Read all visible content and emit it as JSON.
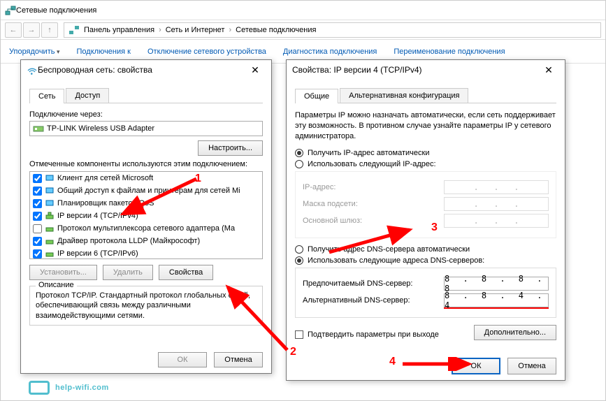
{
  "explorer": {
    "title": "Сетевые подключения",
    "breadcrumb": [
      "Панель управления",
      "Сеть и Интернет",
      "Сетевые подключения"
    ],
    "toolbar": [
      "Упорядочить",
      "Подключения к",
      "Отключение сетевого устройства",
      "Диагностика подключения",
      "Переименование подключения"
    ]
  },
  "dlg1": {
    "title": "Беспроводная сеть: свойства",
    "tabs": [
      "Сеть",
      "Доступ"
    ],
    "connect_label": "Подключение через:",
    "adapter": "TP-LINK Wireless USB Adapter",
    "configure": "Настроить...",
    "components_label": "Отмеченные компоненты используются этим подключением:",
    "components": [
      {
        "checked": true,
        "label": "Клиент для сетей Microsoft"
      },
      {
        "checked": true,
        "label": "Общий доступ к файлам и принтерам для сетей Mi"
      },
      {
        "checked": true,
        "label": "Планировщик пакетов QoS"
      },
      {
        "checked": true,
        "label": "IP версии 4 (TCP/IPv4)"
      },
      {
        "checked": false,
        "label": "Протокол мультиплексора сетевого адаптера (Ма"
      },
      {
        "checked": true,
        "label": "Драйвер протокола LLDP (Майкрософт)"
      },
      {
        "checked": true,
        "label": "IP версии 6 (TCP/IPv6)"
      }
    ],
    "btn_install": "Установить...",
    "btn_remove": "Удалить",
    "btn_props": "Свойства",
    "desc_legend": "Описание",
    "desc": "Протокол TCP/IP. Стандартный протокол глобальных сетей, обеспечивающий связь между различными взаимодействующими сетями.",
    "ok": "ОК",
    "cancel": "Отмена"
  },
  "dlg2": {
    "title": "Свойства: IP версии 4 (TCP/IPv4)",
    "tabs": [
      "Общие",
      "Альтернативная конфигурация"
    ],
    "intro": "Параметры IP можно назначать автоматически, если сеть поддерживает эту возможность. В противном случае узнайте параметры IP у сетевого администратора.",
    "r_ip_auto": "Получить IP-адрес автоматически",
    "r_ip_manual": "Использовать следующий IP-адрес:",
    "ip_label": "IP-адрес:",
    "mask_label": "Маска подсети:",
    "gw_label": "Основной шлюз:",
    "r_dns_auto": "Получить адрес DNS-сервера автоматически",
    "r_dns_manual": "Использовать следующие адреса DNS-серверов:",
    "dns1_label": "Предпочитаемый DNS-сервер:",
    "dns1": "8 . 8 . 8 . 8",
    "dns2_label": "Альтернативный DNS-сервер:",
    "dns2": "8 . 8 . 4 . 4",
    "confirm": "Подтвердить параметры при выходе",
    "advanced": "Дополнительно...",
    "ok": "ОК",
    "cancel": "Отмена"
  },
  "annotations": {
    "n1": "1",
    "n2": "2",
    "n3": "3",
    "n4": "4"
  },
  "watermark": "help-wifi.com"
}
